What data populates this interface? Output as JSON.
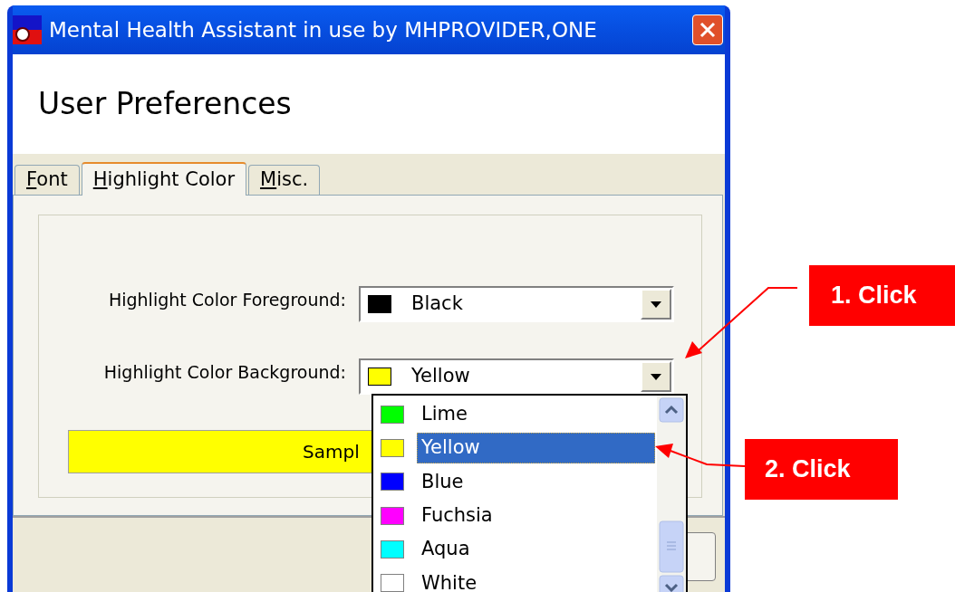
{
  "window": {
    "title": "Mental Health Assistant in use by MHPROVIDER,ONE"
  },
  "header": {
    "title": "User Preferences"
  },
  "tabs": [
    {
      "label": "Font",
      "selected": false
    },
    {
      "label": "Highlight Color",
      "selected": true
    },
    {
      "label": "Misc.",
      "selected": false
    }
  ],
  "fields": [
    {
      "label": "Highlight Color Foreground:",
      "value": "Black",
      "color": "#000000"
    },
    {
      "label": "Highlight Color Background:",
      "value": "Yellow",
      "color": "#ffff00"
    }
  ],
  "sample": {
    "text": "Sampl",
    "color": "#ffff00"
  },
  "dropdown": {
    "items": [
      {
        "label": "Lime",
        "color": "#00ff00",
        "selected": false
      },
      {
        "label": "Yellow",
        "color": "#ffff00",
        "selected": true
      },
      {
        "label": "Blue",
        "color": "#0000ff",
        "selected": false
      },
      {
        "label": "Fuchsia",
        "color": "#ff00ff",
        "selected": false
      },
      {
        "label": "Aqua",
        "color": "#00ffff",
        "selected": false
      },
      {
        "label": "White",
        "color": "#ffffff",
        "selected": false
      }
    ]
  },
  "annotations": [
    {
      "text": "1. Click"
    },
    {
      "text": "2. Click"
    }
  ]
}
